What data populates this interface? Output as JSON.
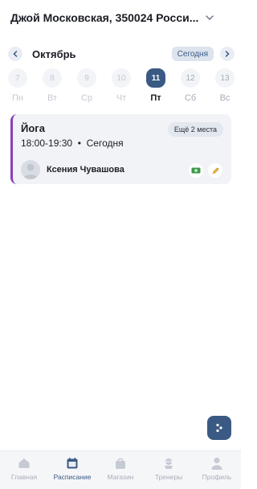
{
  "header": {
    "location": "Джой Московская, 350024 Росси..."
  },
  "calendar": {
    "month": "Октябрь",
    "today_label": "Сегодня",
    "days": [
      {
        "num": "7",
        "wd": "Пн",
        "state": "past"
      },
      {
        "num": "8",
        "wd": "Вт",
        "state": "past"
      },
      {
        "num": "9",
        "wd": "Ср",
        "state": "past"
      },
      {
        "num": "10",
        "wd": "Чт",
        "state": "past"
      },
      {
        "num": "11",
        "wd": "Пт",
        "state": "selected"
      },
      {
        "num": "12",
        "wd": "Сб",
        "state": "future"
      },
      {
        "num": "13",
        "wd": "Вс",
        "state": "future"
      }
    ]
  },
  "session": {
    "title": "Йога",
    "time": "18:00-19:30",
    "separator": "•",
    "day": "Сегодня",
    "spots": "Ещё 2 места",
    "trainer": "Ксения Чувашова",
    "accent_color": "#8a3fb8"
  },
  "tabs": [
    {
      "label": "Главная",
      "icon": "home-icon",
      "active": false
    },
    {
      "label": "Расписание",
      "icon": "calendar-icon",
      "active": true
    },
    {
      "label": "Магазин",
      "icon": "shop-bag-icon",
      "active": false
    },
    {
      "label": "Тренеры",
      "icon": "trainer-icon",
      "active": false
    },
    {
      "label": "Профиль",
      "icon": "profile-icon",
      "active": false
    }
  ],
  "colors": {
    "primary": "#3a5a84",
    "card_bg": "#f1f3f7",
    "muted": "#a7adb8"
  }
}
